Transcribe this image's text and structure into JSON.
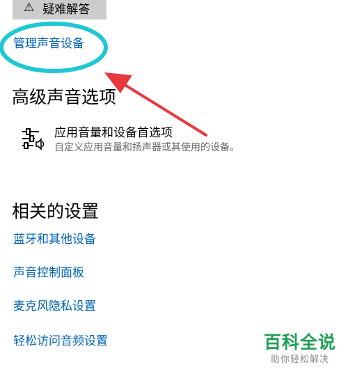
{
  "troubleshoot": {
    "label": "疑难解答",
    "icon": "warning-icon"
  },
  "manage_devices": {
    "label": "管理声音设备"
  },
  "advanced": {
    "title": "高级声音选项",
    "app_volume": {
      "icon": "sliders-icon",
      "title": "应用音量和设备首选项",
      "description": "自定义应用音量和扬声器或其使用的设备。"
    }
  },
  "related": {
    "title": "相关的设置",
    "links": [
      {
        "label": "蓝牙和其他设备"
      },
      {
        "label": "声音控制面板"
      },
      {
        "label": "麦克风隐私设置"
      },
      {
        "label": "轻松访问音频设置"
      }
    ]
  },
  "watermark": {
    "main": "百科全说",
    "sub": "助你轻松解决"
  },
  "colors": {
    "link": "#0063b1",
    "annotation_circle": "#1ec8d2",
    "annotation_arrow": "#e8383d",
    "watermark": "#1fa055"
  }
}
